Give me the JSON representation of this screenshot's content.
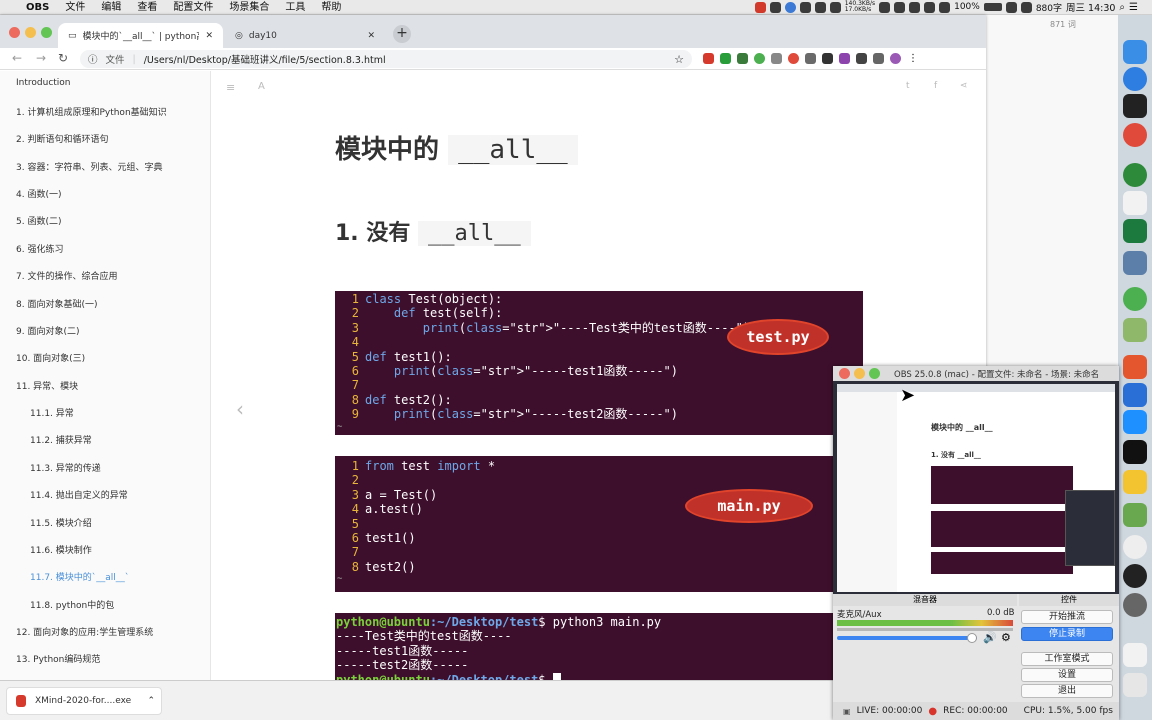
{
  "menubar": {
    "app": "OBS",
    "items": [
      "文件",
      "编辑",
      "查看",
      "配置文件",
      "场景集合",
      "工具",
      "帮助"
    ],
    "net_up": "140.3KB/s",
    "net_down": "17.0KB/s",
    "battery": "100%",
    "input": "880字",
    "clock": "周三 14:30"
  },
  "browser": {
    "tabs": [
      {
        "label": "模块中的`__all__` | python高级"
      },
      {
        "label": "day10"
      }
    ],
    "address_prefix": "文件",
    "address": "/Users/nl/Desktop/基础班讲义/file/5/section.8.3.html"
  },
  "sidebar": {
    "items": [
      {
        "label": "Introduction"
      },
      {
        "label": "1. 计算机组成原理和Python基础知识"
      },
      {
        "label": "2. 判断语句和循环语句"
      },
      {
        "label": "3. 容器：字符串、列表、元组、字典"
      },
      {
        "label": "4. 函数(一)"
      },
      {
        "label": "5. 函数(二)"
      },
      {
        "label": "6. 强化练习"
      },
      {
        "label": "7. 文件的操作、综合应用"
      },
      {
        "label": "8. 面向对象基础(一)"
      },
      {
        "label": "9. 面向对象(二)"
      },
      {
        "label": "10. 面向对象(三)"
      },
      {
        "label": "11. 异常、模块"
      },
      {
        "label": "11.1. 异常"
      },
      {
        "label": "11.2. 捕获异常"
      },
      {
        "label": "11.3. 异常的传递"
      },
      {
        "label": "11.4. 抛出自定义的异常"
      },
      {
        "label": "11.5. 模块介绍"
      },
      {
        "label": "11.6. 模块制作"
      },
      {
        "label": "11.7. 模块中的`__all__`"
      },
      {
        "label": "11.8. python中的包"
      },
      {
        "label": "12. 面向对象的应用:学生管理系统"
      },
      {
        "label": "13. Python编码规范"
      }
    ]
  },
  "content": {
    "title_text": "模块中的",
    "title_code": "__all__",
    "h2_text": "1. 没有",
    "h2_code": "__all__",
    "test_code": [
      {
        "n": "1",
        "code": "class Test(object):"
      },
      {
        "n": "2",
        "code": "    def test(self):"
      },
      {
        "n": "3",
        "code": "        print(\"----Test类中的test函数----\")"
      },
      {
        "n": "4",
        "code": ""
      },
      {
        "n": "5",
        "code": "def test1():"
      },
      {
        "n": "6",
        "code": "    print(\"-----test1函数-----\")"
      },
      {
        "n": "7",
        "code": ""
      },
      {
        "n": "8",
        "code": "def test2():"
      },
      {
        "n": "9",
        "code": "    print(\"-----test2函数-----\")"
      }
    ],
    "test_label": "test.py",
    "main_code": [
      {
        "n": "1",
        "code": "from test import *"
      },
      {
        "n": "2",
        "code": ""
      },
      {
        "n": "3",
        "code": "a = Test()"
      },
      {
        "n": "4",
        "code": "a.test()"
      },
      {
        "n": "5",
        "code": ""
      },
      {
        "n": "6",
        "code": "test1()"
      },
      {
        "n": "7",
        "code": ""
      },
      {
        "n": "8",
        "code": "test2()"
      }
    ],
    "main_label": "main.py",
    "shell": {
      "prompt_user": "python@ubuntu",
      "prompt_path": ":~/Desktop/test",
      "cmd": "$ python3 main.py",
      "output": [
        "----Test类中的test函数----",
        "-----test1函数-----",
        "-----test2函数-----"
      ],
      "prompt2": "$ "
    }
  },
  "word_count": "871 词",
  "obs": {
    "title": "OBS 25.0.8 (mac) - 配置文件: 未命名 - 场景: 未命名",
    "mixer_header": "混音器",
    "controls_header": "控件",
    "source": "麦克风/Aux",
    "db": "0.0 dB",
    "buttons": [
      "开始推流",
      "停止录制",
      "工作室模式",
      "设置",
      "退出"
    ],
    "live": "LIVE: 00:00:00",
    "rec": "REC: 00:00:00",
    "cpu": "CPU: 1.5%, 5.00 fps"
  },
  "download": {
    "file": "XMind-2020-for....exe"
  }
}
